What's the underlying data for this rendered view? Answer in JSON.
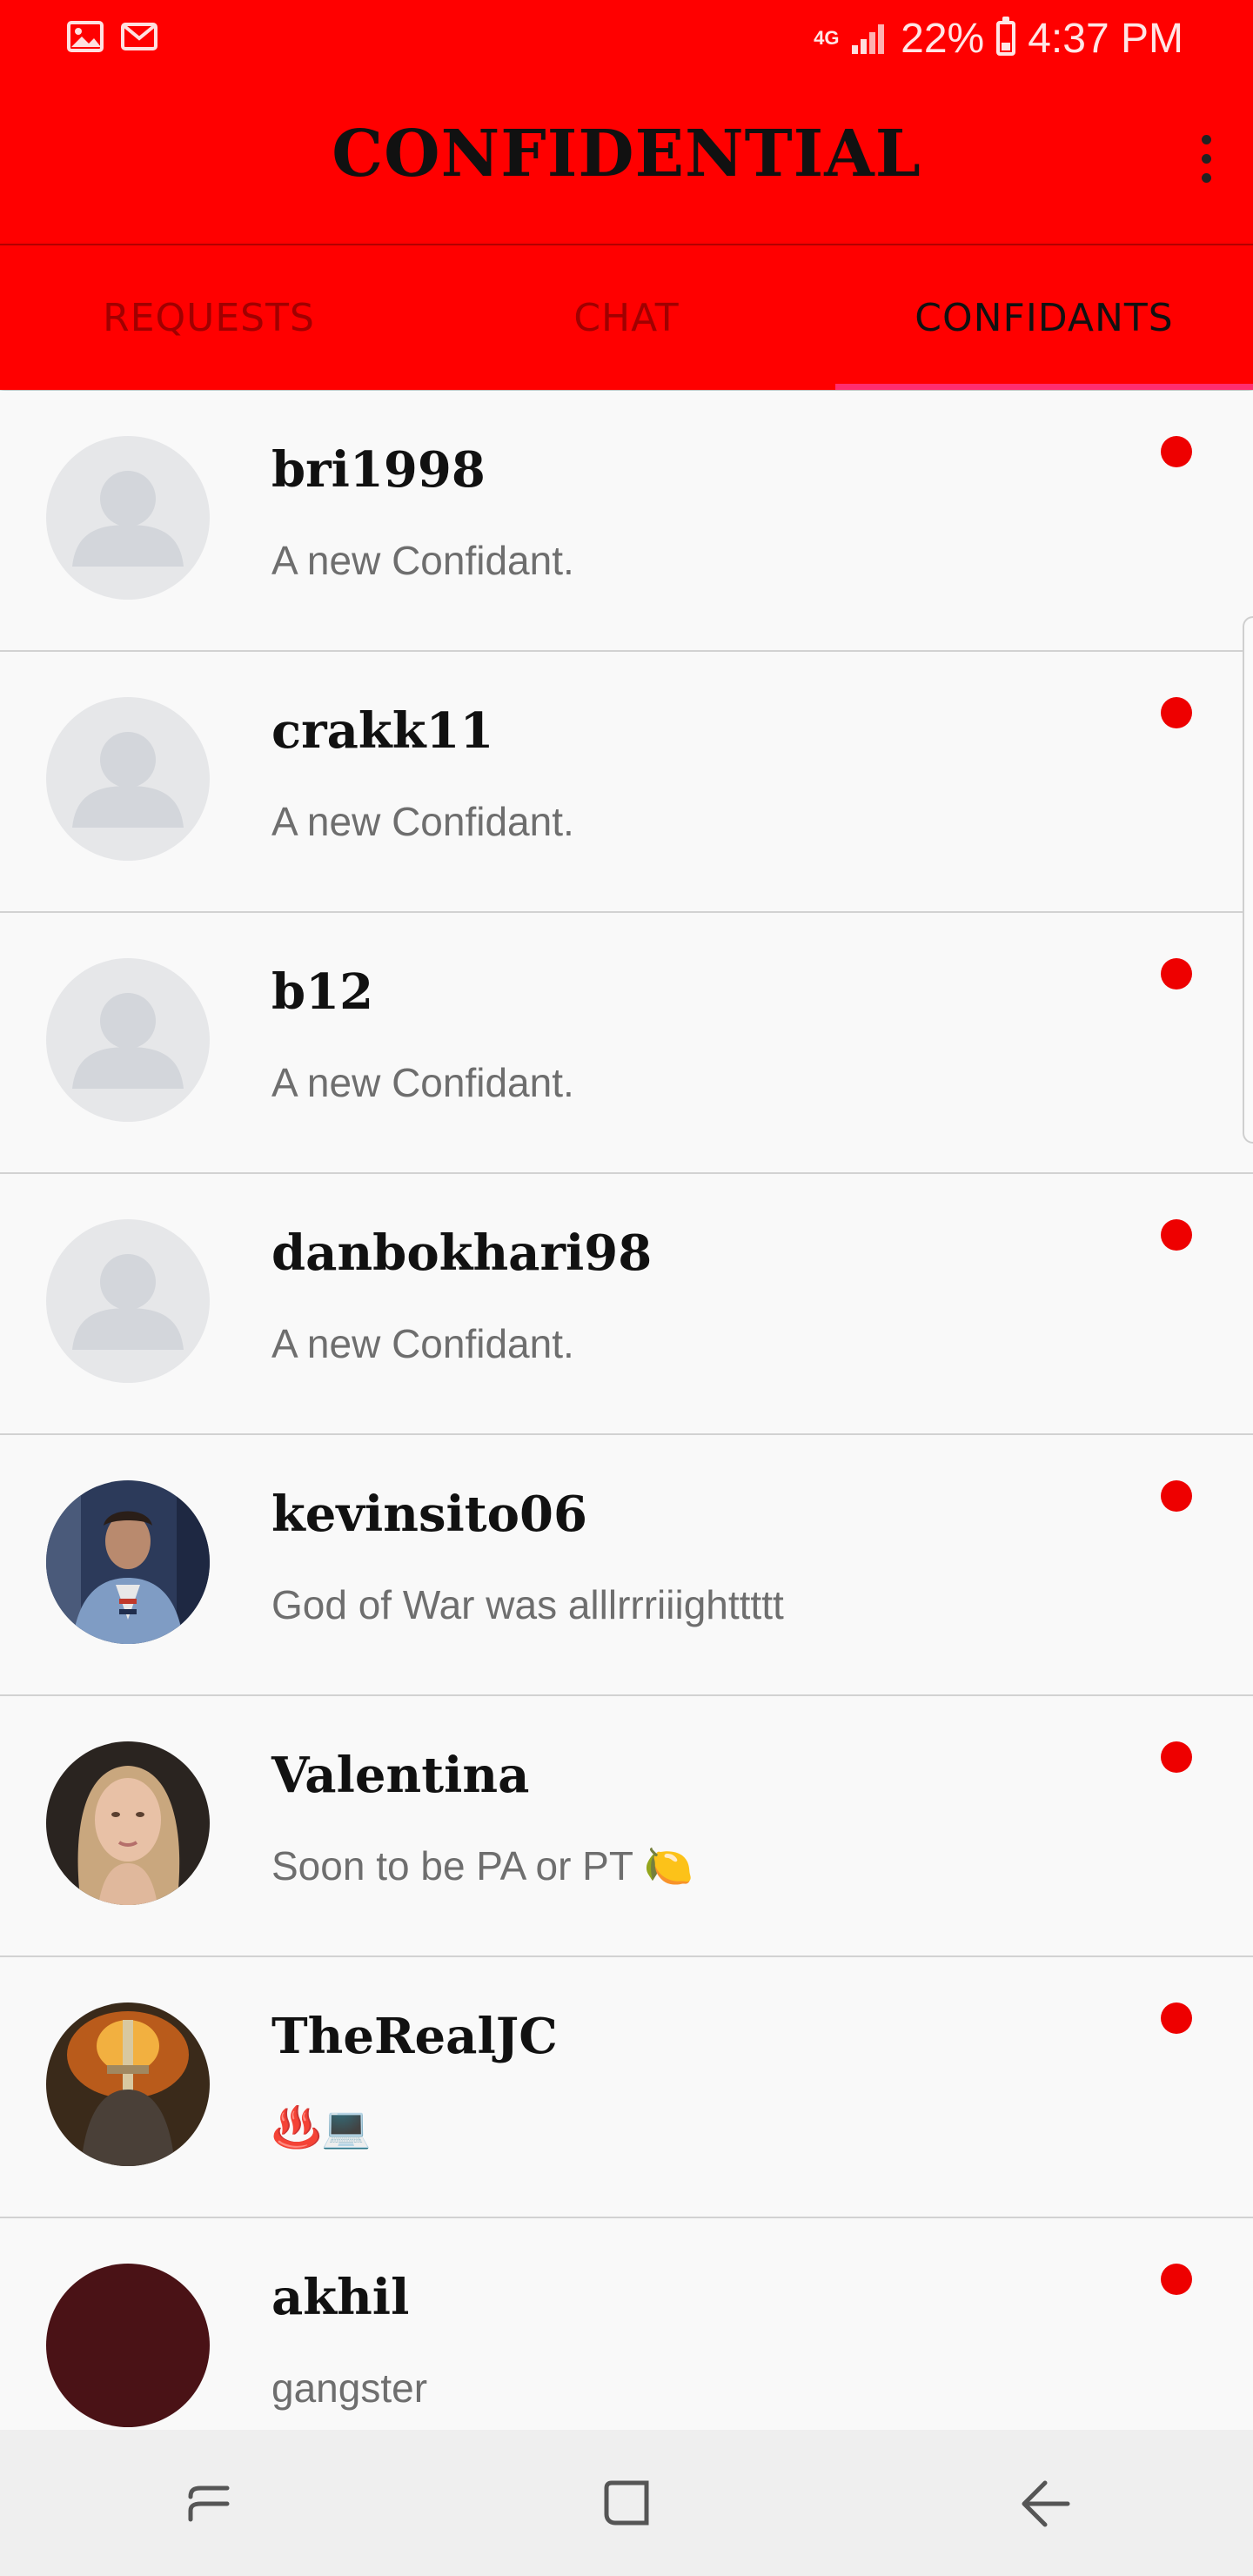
{
  "status_bar": {
    "network": "4G",
    "battery": "22%",
    "time": "4:37 PM",
    "left_icons": [
      "image-icon",
      "gmail-icon"
    ]
  },
  "app_bar": {
    "title": "CONFIDENTIAL",
    "overflow_icon": "more-vert-icon"
  },
  "tabs": [
    {
      "label": "REQUESTS",
      "active": false
    },
    {
      "label": "CHAT",
      "active": false
    },
    {
      "label": "CONFIDANTS",
      "active": true
    }
  ],
  "confidants": [
    {
      "username": "bri1998",
      "preview": "A new Confidant.",
      "avatar": "placeholder",
      "unread": true
    },
    {
      "username": "crakk11",
      "preview": "A new Confidant.",
      "avatar": "placeholder",
      "unread": true
    },
    {
      "username": "b12",
      "preview": "A new Confidant.",
      "avatar": "placeholder",
      "unread": true
    },
    {
      "username": "danbokhari98",
      "preview": "A new Confidant.",
      "avatar": "placeholder",
      "unread": true
    },
    {
      "username": "kevinsito06",
      "preview": "God of War was alllrrriiighttttt",
      "avatar": "photo-man",
      "unread": true
    },
    {
      "username": "Valentina",
      "preview": "Soon to be PA or PT 🍋",
      "avatar": "photo-woman",
      "unread": true
    },
    {
      "username": "TheRealJC",
      "preview": "♨️💻",
      "avatar": "photo-knight",
      "unread": true
    },
    {
      "username": "akhil",
      "preview": "gangster",
      "avatar": "photo-dark-red",
      "unread": true
    }
  ],
  "colors": {
    "primary": "#ff0000",
    "tab_indicator": "#ff2d6f",
    "unread_dot": "#ee0000",
    "nav_bar": "#efefef"
  },
  "nav_bar": {
    "icons": [
      "recent-apps-icon",
      "home-icon",
      "back-icon"
    ]
  }
}
